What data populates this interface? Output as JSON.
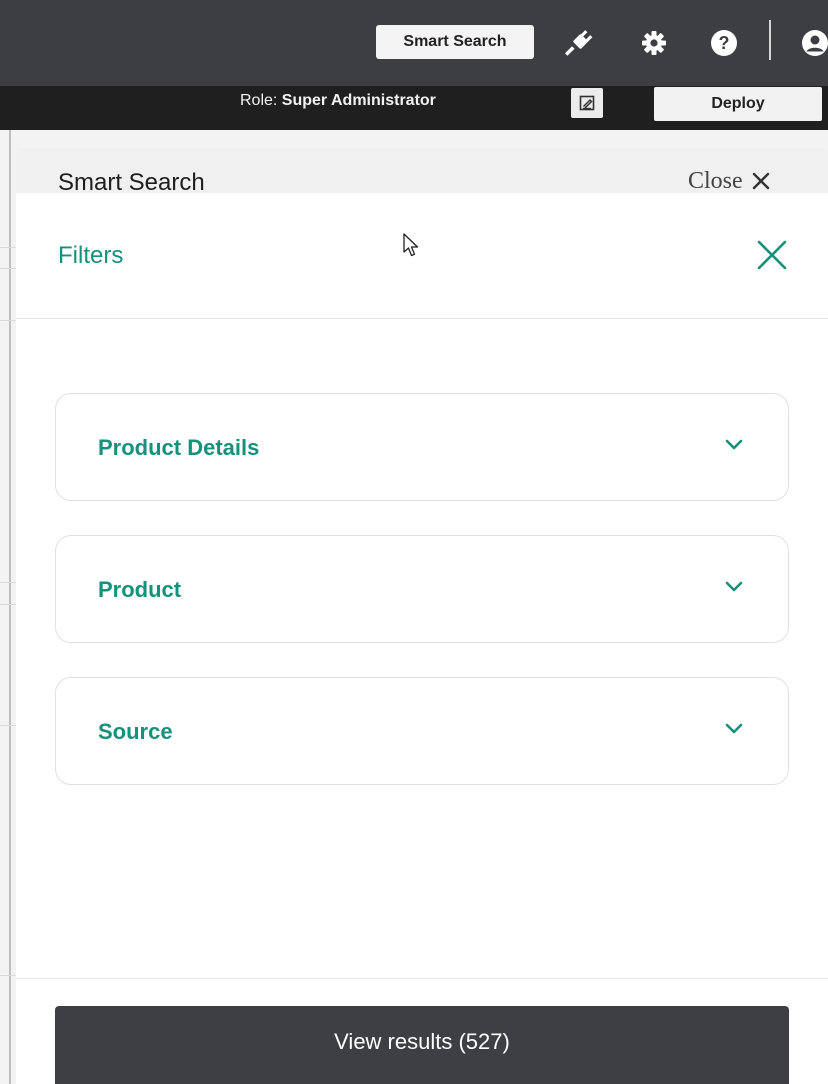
{
  "topbar": {
    "smart_search_label": "Smart Search",
    "icons": [
      "plug-icon",
      "gear-icon",
      "help-icon",
      "user-icon"
    ]
  },
  "rolebar": {
    "role_prefix": "Role: ",
    "role_value": "Super Administrator",
    "deploy_label": "Deploy"
  },
  "panel": {
    "title": "Smart Search",
    "close_label": "Close"
  },
  "filters": {
    "title": "Filters",
    "sections": [
      {
        "label": "Product Details"
      },
      {
        "label": "Product"
      },
      {
        "label": "Source"
      }
    ]
  },
  "footer": {
    "view_results_label": "View results (527)"
  },
  "colors": {
    "accent": "#17907c",
    "topbar": "#3d3e42",
    "rolebar": "#1f1f1f",
    "button_dark": "#3d3f44"
  }
}
